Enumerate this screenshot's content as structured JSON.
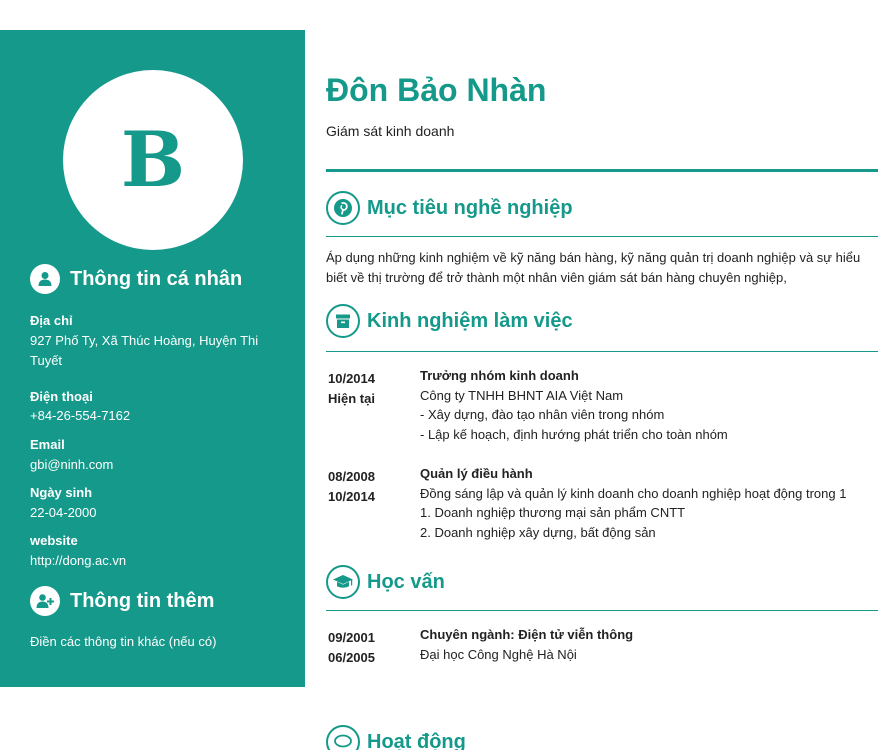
{
  "profile": {
    "initial": "B",
    "name": "Đôn Bảo Nhàn",
    "job_title": "Giám sát kinh doanh"
  },
  "sidebar": {
    "personal_heading": "Thông tin cá nhân",
    "fields": [
      {
        "label": "Địa chỉ",
        "value": "927 Phố Ty, Xã Thúc Hoàng, Huyện Thi Tuyết"
      },
      {
        "label": "Điện thoại",
        "value": "+84-26-554-7162"
      },
      {
        "label": "Email",
        "value": "gbi@ninh.com"
      },
      {
        "label": "Ngày sinh",
        "value": "22-04-2000"
      },
      {
        "label": "website",
        "value": "http://dong.ac.vn"
      }
    ],
    "extra_heading": "Thông tin thêm",
    "extra_text": "Điền các thông tin khác (nếu có)"
  },
  "objective": {
    "title": "Mục tiêu nghề nghiệp",
    "text": "Áp dụng những kinh nghiệm về kỹ năng bán hàng, kỹ năng quản trị doanh nghiệp và sự hiểu biết về thị trường để trở thành một nhân viên giám sát bán hàng chuyên nghiệp,"
  },
  "experience": {
    "title": "Kinh nghiệm làm việc",
    "items": [
      {
        "start": "10/2014",
        "end": "Hiện tại",
        "role": "Trưởng nhóm kinh doanh",
        "lines": [
          "Công ty TNHH BHNT AIA Việt Nam",
          "- Xây dựng, đào tạo nhân viên trong nhóm",
          "- Lập kế hoạch, định hướng phát triển cho toàn nhóm"
        ]
      },
      {
        "start": "08/2008",
        "end": "10/2014",
        "role": "Quản lý điều hành",
        "lines": [
          "Đồng sáng lập và quản lý kinh doanh cho doanh nghiệp hoạt động trong 1",
          "1. Doanh nghiệp thương mại sản phẩm CNTT",
          "2. Doanh nghiệp xây dựng, bất động sản"
        ]
      }
    ]
  },
  "education": {
    "title": "Học vấn",
    "items": [
      {
        "start": "09/2001",
        "end": "06/2005",
        "major": "Chuyên ngành: Điện tử viễn thông",
        "school": "Đại học Công Nghệ Hà Nội"
      }
    ]
  },
  "activities": {
    "title": "Hoạt động"
  },
  "icons": {
    "personal": "user-icon",
    "extra": "user-plus-icon",
    "objective": "pinterest-icon",
    "experience": "archive-box-icon",
    "education": "graduation-cap-icon",
    "activities": "speech-bubble-icon"
  },
  "colors": {
    "accent": "#14998a",
    "text": "#222222",
    "background": "#ffffff"
  }
}
